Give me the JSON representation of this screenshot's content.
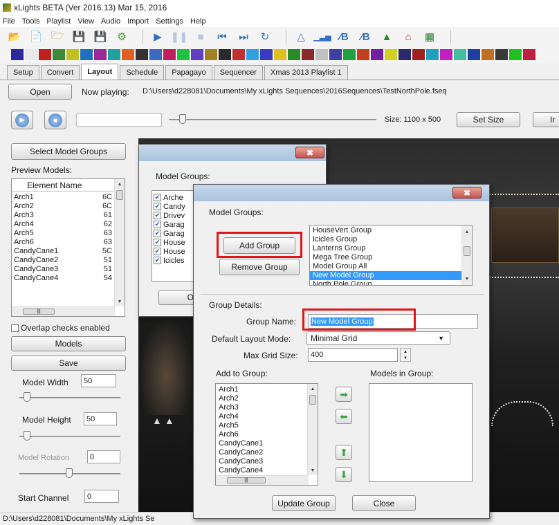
{
  "window": {
    "title": "xLights BETA (Ver 2016.13) Mar 15, 2016"
  },
  "menu": [
    "File",
    "Tools",
    "Playlist",
    "View",
    "Audio",
    "Import",
    "Settings",
    "Help"
  ],
  "tabs": [
    "Setup",
    "Convert",
    "Layout",
    "Schedule",
    "Papagayo",
    "Sequencer",
    "Xmas 2013 Playlist 1"
  ],
  "active_tab": "Layout",
  "playback": {
    "open_label": "Open",
    "now_playing_label": "Now playing:",
    "now_playing_path": "D:\\Users\\d228081\\Documents\\My xLights Sequences\\2016Sequences\\TestNorthPole.fseq"
  },
  "canvas": {
    "size_label": "Size: 1100 x 500",
    "set_size_label": "Set Size",
    "partial_label": "Ir"
  },
  "left_panel": {
    "select_groups_label": "Select Model Groups",
    "preview_models_label": "Preview Models:",
    "column_header": "Element Name",
    "models": [
      {
        "name": "Arch1",
        "channel": "6C"
      },
      {
        "name": "Arch2",
        "channel": "6C"
      },
      {
        "name": "Arch3",
        "channel": "61"
      },
      {
        "name": "Arch4",
        "channel": "62"
      },
      {
        "name": "Arch5",
        "channel": "63"
      },
      {
        "name": "Arch6",
        "channel": "63"
      },
      {
        "name": "CandyCane1",
        "channel": "5C"
      },
      {
        "name": "CandyCane2",
        "channel": "51"
      },
      {
        "name": "CandyCane3",
        "channel": "51"
      },
      {
        "name": "CandyCane4",
        "channel": "54"
      }
    ],
    "overlap_label": "Overlap checks enabled",
    "models_button": "Models",
    "save_button": "Save",
    "model_width_label": "Model Width",
    "model_width_value": "50",
    "model_height_label": "Model Height",
    "model_height_value": "50",
    "model_rotation_label": "Model Rotation",
    "model_rotation_value": "0",
    "start_channel_label": "Start Channel",
    "start_channel_value": "0"
  },
  "status_bar": {
    "text": "D:\\Users\\d228081\\Documents\\My xLights Se"
  },
  "back_dialog": {
    "model_groups_label": "Model Groups:",
    "groups": [
      "Arche",
      "Candy",
      "Drivev",
      "Garag",
      "Garag",
      "House",
      "House",
      "Icicles"
    ],
    "ok_partial": "O"
  },
  "front_dialog": {
    "model_groups_label": "Model Groups:",
    "add_group": "Add Group",
    "remove_group": "Remove Group",
    "group_list": [
      "HouseVert Group",
      "Icicles Group",
      "Lanterns Group",
      "Mega Tree Group",
      "Model Group All",
      "New Model Group",
      "North Pole Group"
    ],
    "selected_group": "New Model Group",
    "group_details_label": "Group Details:",
    "group_name_label": "Group Name:",
    "group_name_value": "New Model Group",
    "layout_mode_label": "Default Layout Mode:",
    "layout_mode_value": "Minimal Grid",
    "max_grid_label": "Max Grid Size:",
    "max_grid_value": "400",
    "add_to_group_label": "Add to Group:",
    "models_in_group_label": "Models in Group:",
    "add_list": [
      "Arch1",
      "Arch2",
      "Arch3",
      "Arch4",
      "Arch5",
      "Arch6",
      "CandyCane1",
      "CandyCane2",
      "CandyCane3",
      "CandyCane4"
    ],
    "update_group": "Update Group",
    "close": "Close"
  },
  "colors": {
    "highlight": "#e0151a",
    "selection": "#3399ff"
  }
}
